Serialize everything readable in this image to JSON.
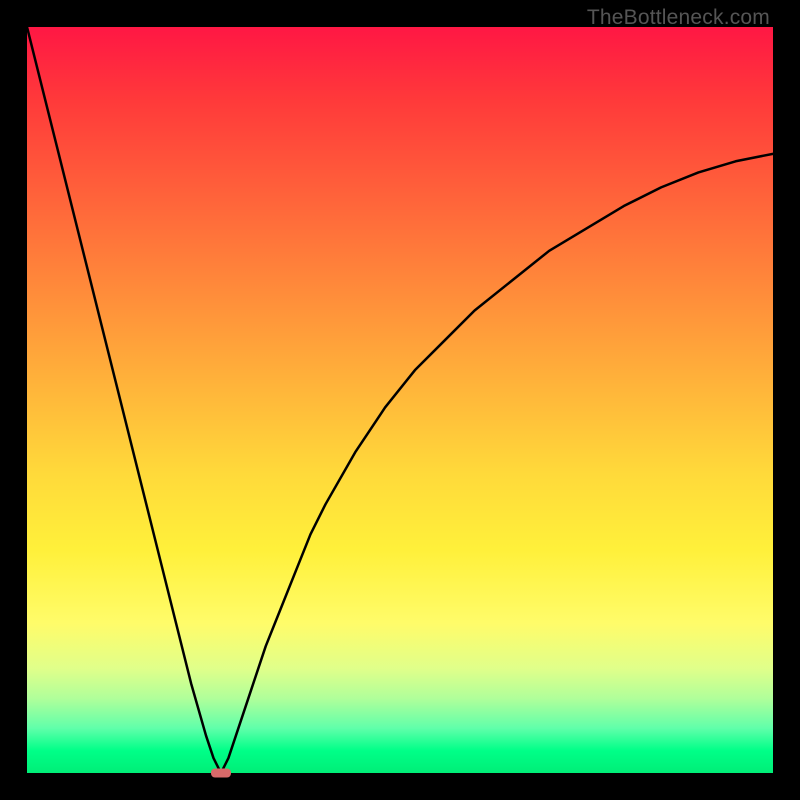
{
  "watermark": "TheBottleneck.com",
  "chart_data": {
    "type": "line",
    "title": "",
    "xlabel": "",
    "ylabel": "",
    "xlim": [
      0,
      100
    ],
    "ylim": [
      0,
      100
    ],
    "x": [
      0,
      2,
      4,
      6,
      8,
      10,
      12,
      14,
      16,
      18,
      20,
      22,
      24,
      25,
      26,
      27,
      28,
      30,
      32,
      34,
      36,
      38,
      40,
      44,
      48,
      52,
      56,
      60,
      65,
      70,
      75,
      80,
      85,
      90,
      95,
      100
    ],
    "values": [
      100,
      92,
      84,
      76,
      68,
      60,
      52,
      44,
      36,
      28,
      20,
      12,
      5,
      2,
      0,
      2,
      5,
      11,
      17,
      22,
      27,
      32,
      36,
      43,
      49,
      54,
      58,
      62,
      66,
      70,
      73,
      76,
      78.5,
      80.5,
      82,
      83
    ],
    "marker": {
      "x": 26,
      "y": 0,
      "color": "#d86a6a"
    },
    "gradient_bg": {
      "top": "#ff1744",
      "middle": "#ffda3a",
      "bottom": "#00ee77"
    }
  }
}
